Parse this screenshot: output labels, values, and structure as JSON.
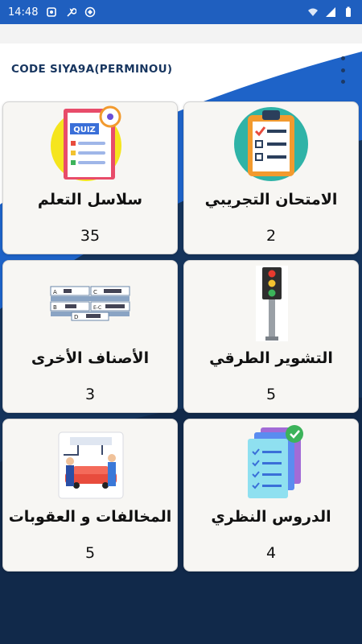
{
  "status_bar": {
    "time": "14:48",
    "left_icons": [
      "notification-icon",
      "wrench-icon",
      "vpn-icon"
    ],
    "right_icons": [
      "wifi-icon",
      "signal-icon",
      "battery-icon"
    ]
  },
  "app_bar": {
    "title": "CODE SIYA9A(PERMINOU)",
    "menu_icon": "more-vert-icon"
  },
  "cards": [
    {
      "id": "quiz-series",
      "label": "سلاسل التعلم",
      "count": "35",
      "icon": "quiz-icon"
    },
    {
      "id": "mock-exam",
      "label": "الامتحان التجريبي",
      "count": "2",
      "icon": "clipboard-checklist-icon"
    },
    {
      "id": "other-categories",
      "label": "الأصناف الأخرى",
      "count": "3",
      "icon": "vehicle-categories-icon"
    },
    {
      "id": "road-signs",
      "label": "التشوير الطرقي",
      "count": "5",
      "icon": "traffic-light-icon"
    },
    {
      "id": "violations",
      "label": "المخالفات و العقوبات",
      "count": "5",
      "icon": "police-car-icon"
    },
    {
      "id": "theory-lessons",
      "label": "الدروس النظري",
      "count": "4",
      "icon": "checklist-stack-icon"
    }
  ],
  "vehicle_categories": [
    "A",
    "B",
    "C",
    "E-C",
    "D"
  ],
  "colors": {
    "status_bar": "#1f5fbf",
    "wave_dark": "#122a4a",
    "wave_blue": "#1e63c8",
    "card_bg": "#f7f6f3",
    "title": "#17355f"
  }
}
